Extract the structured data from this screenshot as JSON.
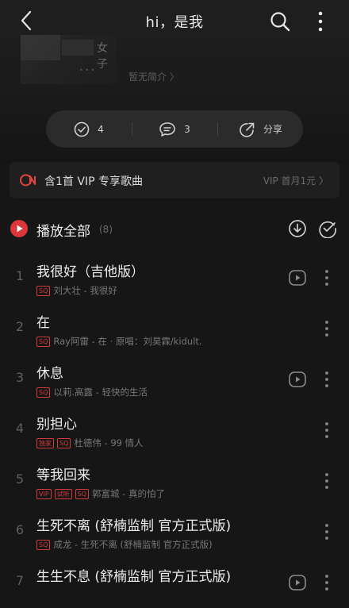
{
  "header": {
    "title": "hi，是我"
  },
  "cover": {
    "fragment_text": "女子"
  },
  "intro_label": "暂无简介 〉",
  "actions": {
    "likes": "4",
    "comments": "3",
    "share": "分享"
  },
  "vip_banner": {
    "text": "含1首 VIP 专享歌曲",
    "offer": "VIP 首月1元 〉"
  },
  "play_all": {
    "label": "播放全部",
    "count": "(8)"
  },
  "songs": [
    {
      "index": "1",
      "title": "我很好（吉他版）",
      "tags": [
        "SQ"
      ],
      "artist": "刘大壮 - 我很好",
      "mv": true
    },
    {
      "index": "2",
      "title": "在",
      "tags": [
        "SQ"
      ],
      "artist": "Ray阿雷 - 在 · 原唱：刘昊霖/kidult.",
      "mv": false
    },
    {
      "index": "3",
      "title": "休息",
      "tags": [
        "SQ"
      ],
      "artist": "以莉.高露 - 轻快的生活",
      "mv": true
    },
    {
      "index": "4",
      "title": "别担心",
      "tags": [
        "独家",
        "SQ"
      ],
      "artist": "杜德伟 - 99 情人",
      "mv": false
    },
    {
      "index": "5",
      "title": "等我回来",
      "tags": [
        "VIP",
        "试听",
        "SQ"
      ],
      "artist": "郭富城 - 真的怕了",
      "mv": false
    },
    {
      "index": "6",
      "title": "生死不离 (舒楠监制 官方正式版)",
      "tags": [
        "SQ"
      ],
      "artist": "成龙 - 生死不离 (舒楠监制 官方正式版)",
      "mv": false
    },
    {
      "index": "7",
      "title": "生生不息 (舒楠监制 官方正式版)",
      "tags": [],
      "artist": "",
      "mv": true
    }
  ],
  "colors": {
    "accent": "#d9373a",
    "background": "#161616",
    "pill": "#2b2b2b"
  }
}
